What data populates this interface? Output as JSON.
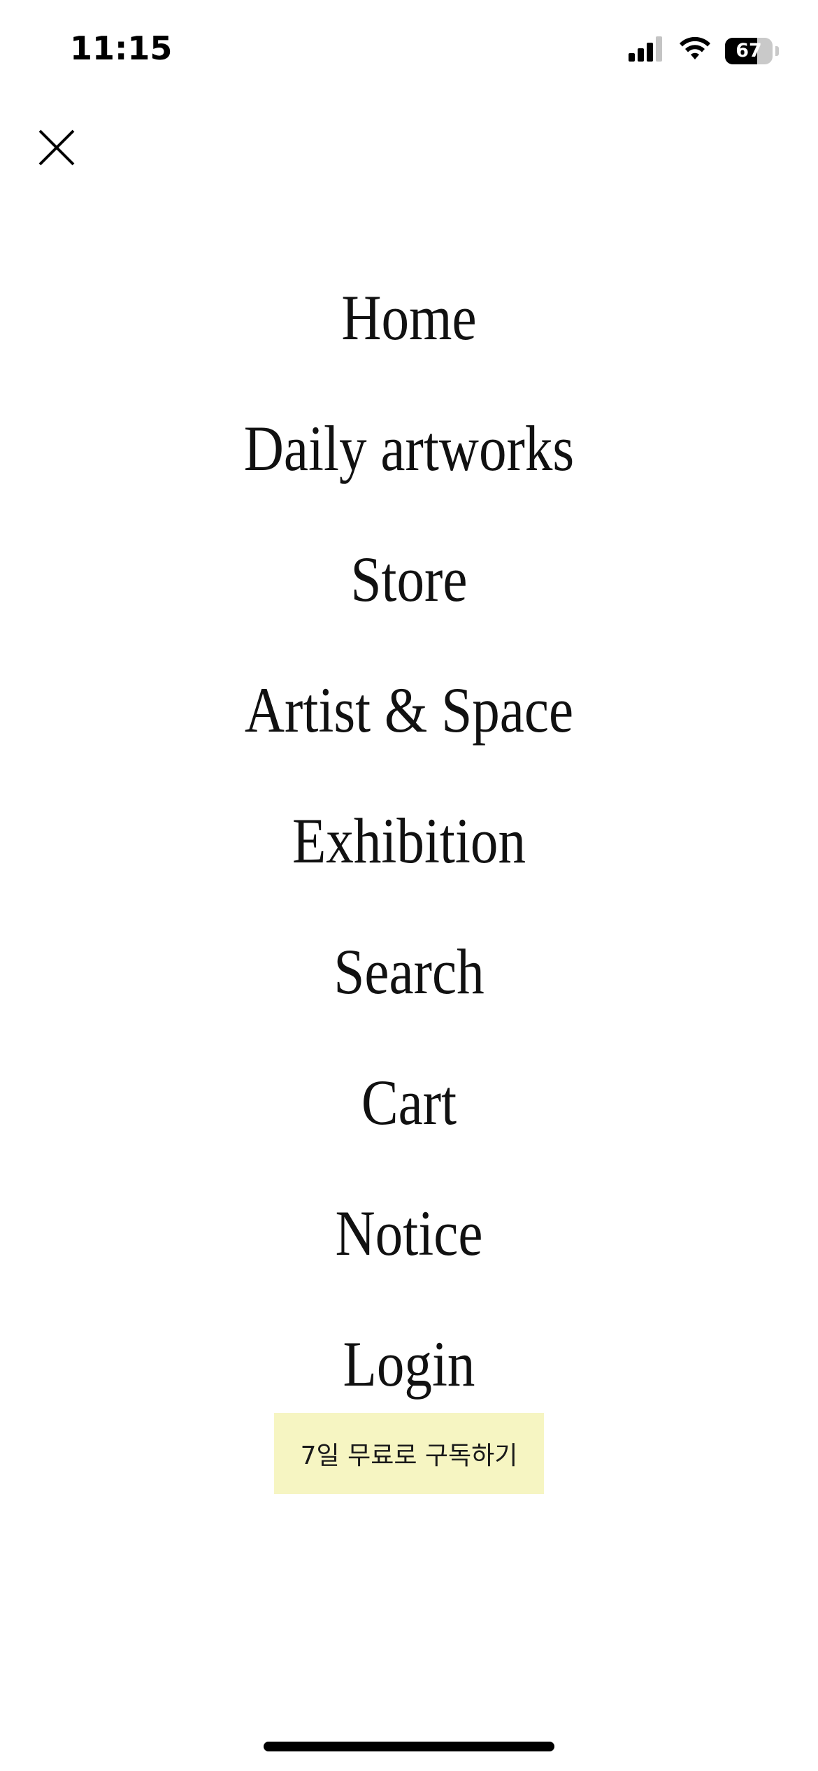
{
  "status_bar": {
    "time": "11:15",
    "battery_level": 67,
    "battery_text": "67",
    "icons": [
      "cellular-signal-icon",
      "wifi-icon",
      "battery-icon"
    ]
  },
  "close_icon": "close-icon",
  "menu": {
    "items": [
      {
        "label": "Home"
      },
      {
        "label": "Daily artworks"
      },
      {
        "label": "Store"
      },
      {
        "label": "Artist & Space"
      },
      {
        "label": "Exhibition"
      },
      {
        "label": "Search"
      },
      {
        "label": "Cart"
      },
      {
        "label": "Notice"
      },
      {
        "label": "Login"
      }
    ]
  },
  "subscribe": {
    "label": "7일 무료로 구독하기",
    "bg_color": "#f6f5c2"
  }
}
